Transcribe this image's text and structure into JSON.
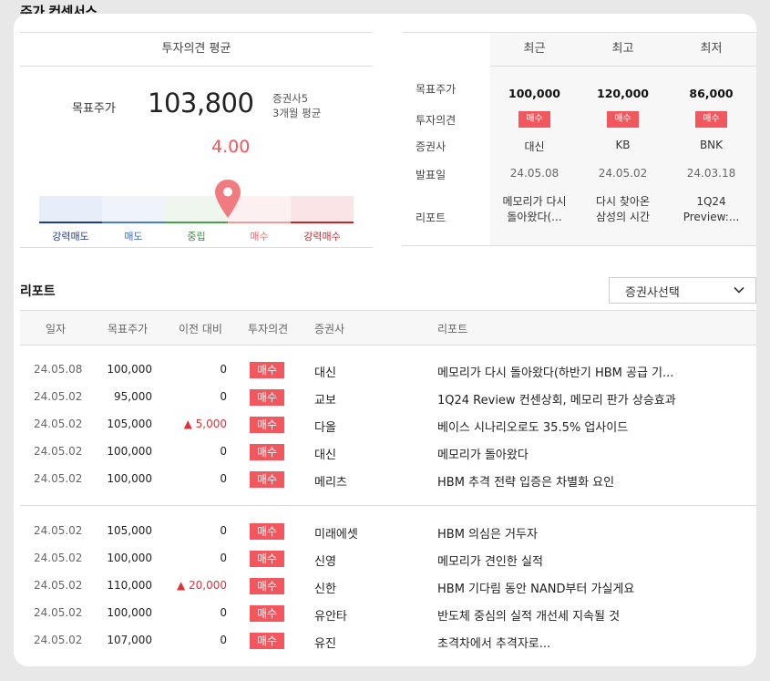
{
  "page_title": "주가 컨센서스",
  "consensus": {
    "header": "투자의견 평균",
    "target_label": "목표주가",
    "target_value": "103,800",
    "analyst_count": "증권사5",
    "period": "3개월 평균",
    "score": "4.00",
    "score_value": 4.0,
    "gauge_labels": [
      "강력매도",
      "매도",
      "중립",
      "매수",
      "강력매수"
    ]
  },
  "summary": {
    "columns": [
      "최근",
      "최고",
      "최저"
    ],
    "row_labels": [
      "목표주가",
      "투자의견",
      "증권사",
      "발표일",
      "리포트"
    ],
    "cells": [
      {
        "price": "100,000",
        "opinion": "매수",
        "firm": "대신",
        "date": "24.05.08",
        "report": [
          "메모리가 다시",
          "돌아왔다(..."
        ]
      },
      {
        "price": "120,000",
        "opinion": "매수",
        "firm": "KB",
        "date": "24.05.02",
        "report": [
          "다시 찾아온",
          "삼성의 시간"
        ]
      },
      {
        "price": "86,000",
        "opinion": "매수",
        "firm": "BNK",
        "date": "24.03.18",
        "report": [
          "1Q24",
          "Preview:..."
        ]
      }
    ]
  },
  "reports": {
    "title": "리포트",
    "dropdown_label": "증권사선택",
    "headers": [
      "일자",
      "목표주가",
      "이전 대비",
      "투자의견",
      "증권사",
      "리포트"
    ],
    "rows": [
      {
        "date": "24.05.08",
        "price": "100,000",
        "diff": "0",
        "opinion": "매수",
        "firm": "대신",
        "title": "메모리가 다시 돌아왔다(하반기 HBM 공급 기..."
      },
      {
        "date": "24.05.02",
        "price": "95,000",
        "diff": "0",
        "opinion": "매수",
        "firm": "교보",
        "title": "1Q24 Review 컨센상회, 메모리 판가 상승효과"
      },
      {
        "date": "24.05.02",
        "price": "105,000",
        "diff": "▲ 5,000",
        "opinion": "매수",
        "firm": "다올",
        "title": "베이스 시나리오로도 35.5% 업사이드"
      },
      {
        "date": "24.05.02",
        "price": "100,000",
        "diff": "0",
        "opinion": "매수",
        "firm": "대신",
        "title": "메모리가 돌아왔다"
      },
      {
        "date": "24.05.02",
        "price": "100,000",
        "diff": "0",
        "opinion": "매수",
        "firm": "메리츠",
        "title": "HBM 추격 전략 입증은 차별화 요인"
      },
      {
        "date": "24.05.02",
        "price": "105,000",
        "diff": "0",
        "opinion": "매수",
        "firm": "미래에셋",
        "title": "HBM 의심은 거두자"
      },
      {
        "date": "24.05.02",
        "price": "100,000",
        "diff": "0",
        "opinion": "매수",
        "firm": "신영",
        "title": "메모리가 견인한 실적"
      },
      {
        "date": "24.05.02",
        "price": "110,000",
        "diff": "▲ 20,000",
        "opinion": "매수",
        "firm": "신한",
        "title": "HBM 기다림 동안 NAND부터 가실게요"
      },
      {
        "date": "24.05.02",
        "price": "100,000",
        "diff": "0",
        "opinion": "매수",
        "firm": "유안타",
        "title": "반도체 중심의 실적 개선세 지속될 것"
      },
      {
        "date": "24.05.02",
        "price": "107,000",
        "diff": "0",
        "opinion": "매수",
        "firm": "유진",
        "title": "초격차에서 추격자로..."
      }
    ]
  },
  "colors": {
    "accent": "#f2575e",
    "up": "#e0323a"
  }
}
